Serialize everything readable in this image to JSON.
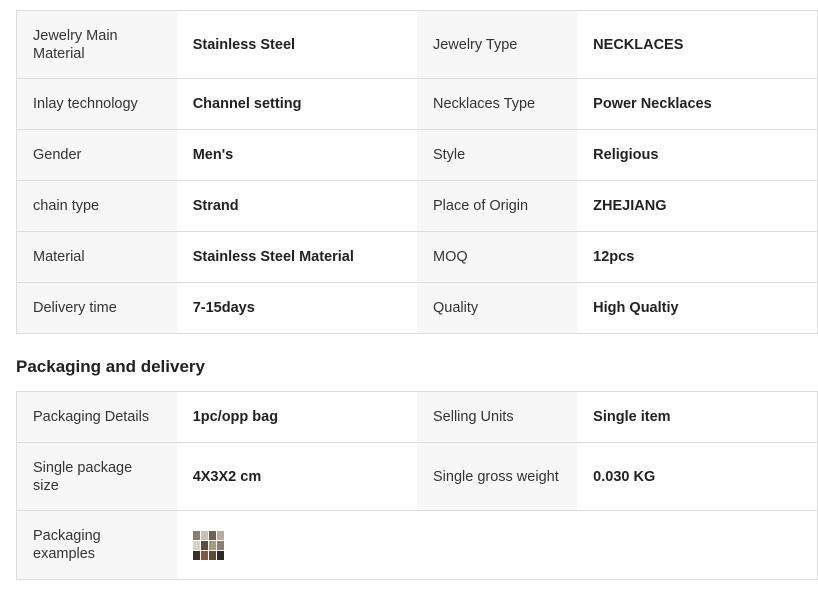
{
  "specs": {
    "rows": [
      {
        "k1": "Jewelry Main Material",
        "v1": "Stainless Steel",
        "k2": "Jewelry Type",
        "v2": "NECKLACES"
      },
      {
        "k1": "Inlay technology",
        "v1": "Channel setting",
        "k2": "Necklaces Type",
        "v2": "Power Necklaces"
      },
      {
        "k1": "Gender",
        "v1": "Men's",
        "k2": "Style",
        "v2": "Religious"
      },
      {
        "k1": "chain type",
        "v1": "Strand",
        "k2": "Place of Origin",
        "v2": "ZHEJIANG"
      },
      {
        "k1": "Material",
        "v1": "Stainless Steel Material",
        "k2": "MOQ",
        "v2": "12pcs"
      },
      {
        "k1": "Delivery time",
        "v1": "7-15days",
        "k2": "Quality",
        "v2": "High Qualtiy"
      }
    ]
  },
  "packaging": {
    "title": "Packaging and delivery",
    "rows": [
      {
        "k1": "Packaging Details",
        "v1": "1pc/opp bag",
        "k2": "Selling Units",
        "v2": "Single item"
      },
      {
        "k1": "Single package size",
        "v1": "4X3X2 cm",
        "k2": "Single gross weight",
        "v2": "0.030 KG"
      }
    ],
    "examples_label": "Packaging examples",
    "thumbnail_colors": [
      "#8a7f74",
      "#c9c1b6",
      "#6f6254",
      "#b8ad9e",
      "#d8d2c9",
      "#5a4e44",
      "#a8997f",
      "#8c7f71",
      "#3a3029",
      "#7b5c40",
      "#5d4a3a",
      "#2f2822"
    ]
  }
}
